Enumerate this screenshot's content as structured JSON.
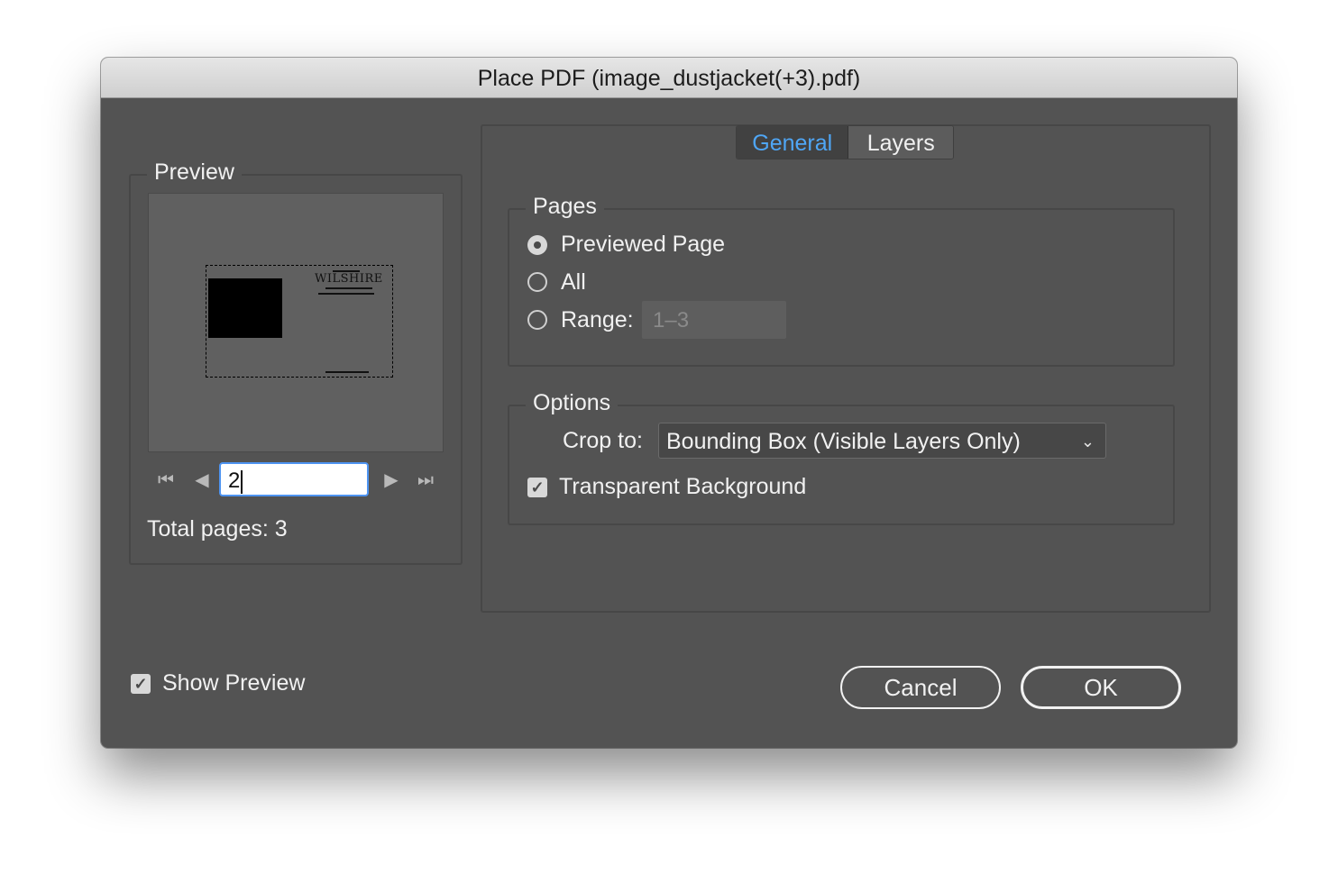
{
  "window": {
    "title": "Place PDF (image_dustjacket(+3).pdf)"
  },
  "preview": {
    "group_title": "Preview",
    "thumbnail": {
      "logo_title": "WILSHIRE"
    },
    "nav": {
      "first_icon": "skip-first-icon",
      "prev_icon": "prev-icon",
      "next_icon": "next-icon",
      "last_icon": "skip-last-icon"
    },
    "page_input_value": "2",
    "total_pages_label": "Total pages: 3"
  },
  "tabs": [
    {
      "label": "General",
      "active": true
    },
    {
      "label": "Layers",
      "active": false
    }
  ],
  "pages": {
    "group_title": "Pages",
    "options": [
      {
        "label": "Previewed Page",
        "selected": true
      },
      {
        "label": "All",
        "selected": false
      },
      {
        "label": "Range:",
        "selected": false
      }
    ],
    "range_placeholder": "1–3"
  },
  "options": {
    "group_title": "Options",
    "crop_label": "Crop to:",
    "crop_value": "Bounding Box (Visible Layers Only)",
    "transparent_bg_label": "Transparent Background",
    "transparent_bg_checked": true
  },
  "footer": {
    "show_preview_label": "Show Preview",
    "show_preview_checked": true,
    "cancel_label": "Cancel",
    "ok_label": "OK"
  },
  "colors": {
    "dialog_bg": "#535353",
    "accent": "#4fa6f5",
    "focus_ring": "#4e94f1"
  }
}
